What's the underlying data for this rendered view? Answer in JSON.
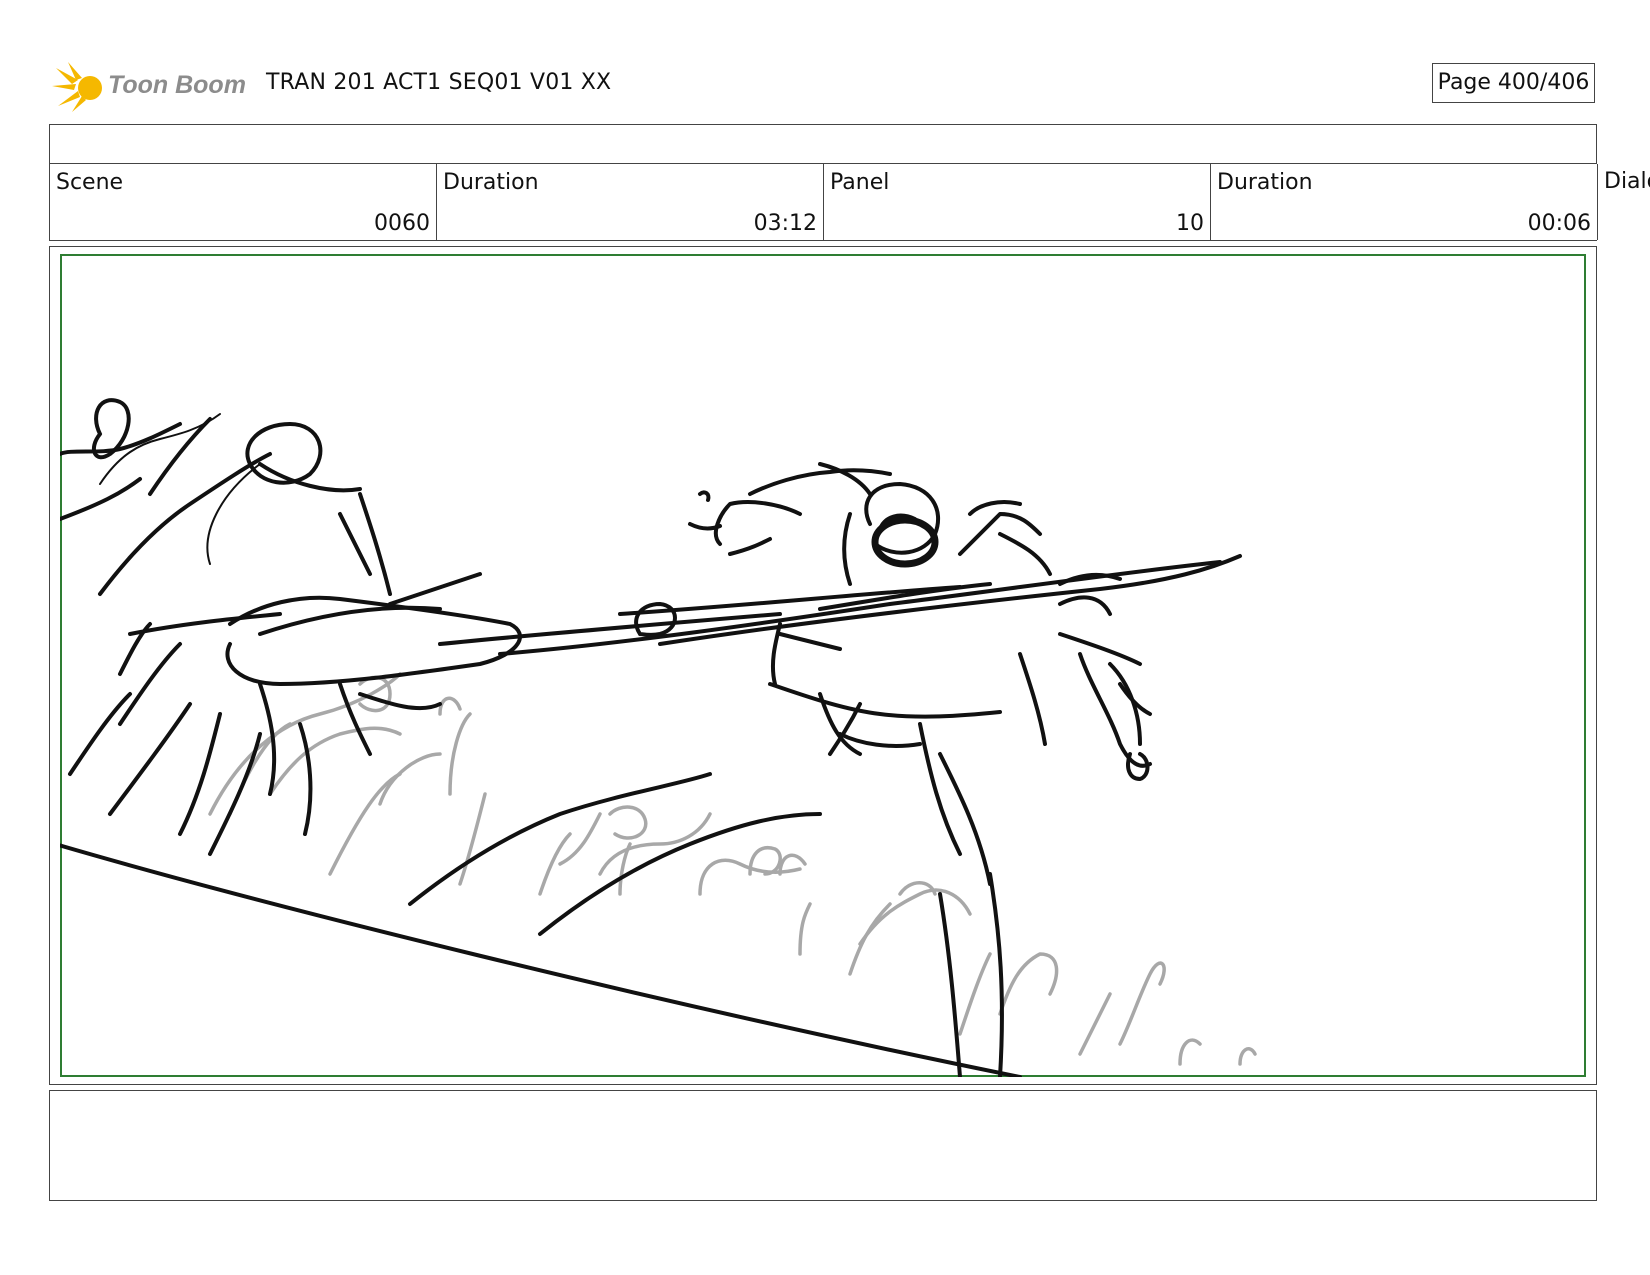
{
  "header": {
    "logo_text": "Toon Boom",
    "title": "TRAN 201 ACT1 SEQ01 V01 XX",
    "page": "Page 400/406"
  },
  "info": {
    "scene_label": "Scene",
    "scene_value": "0060",
    "scene_duration_label": "Duration",
    "scene_duration_value": "03:12",
    "panel_label": "Panel",
    "panel_value": "10",
    "panel_duration_label": "Duration",
    "panel_duration_value": "00:06",
    "dialog_label": "Dialog"
  },
  "colors": {
    "logo_accent": "#F5B800",
    "logo_text": "#8C8C8C",
    "panel_border": "#2E7D32",
    "sketch_ink": "#111111",
    "sketch_secondary": "#A8A8A8"
  }
}
